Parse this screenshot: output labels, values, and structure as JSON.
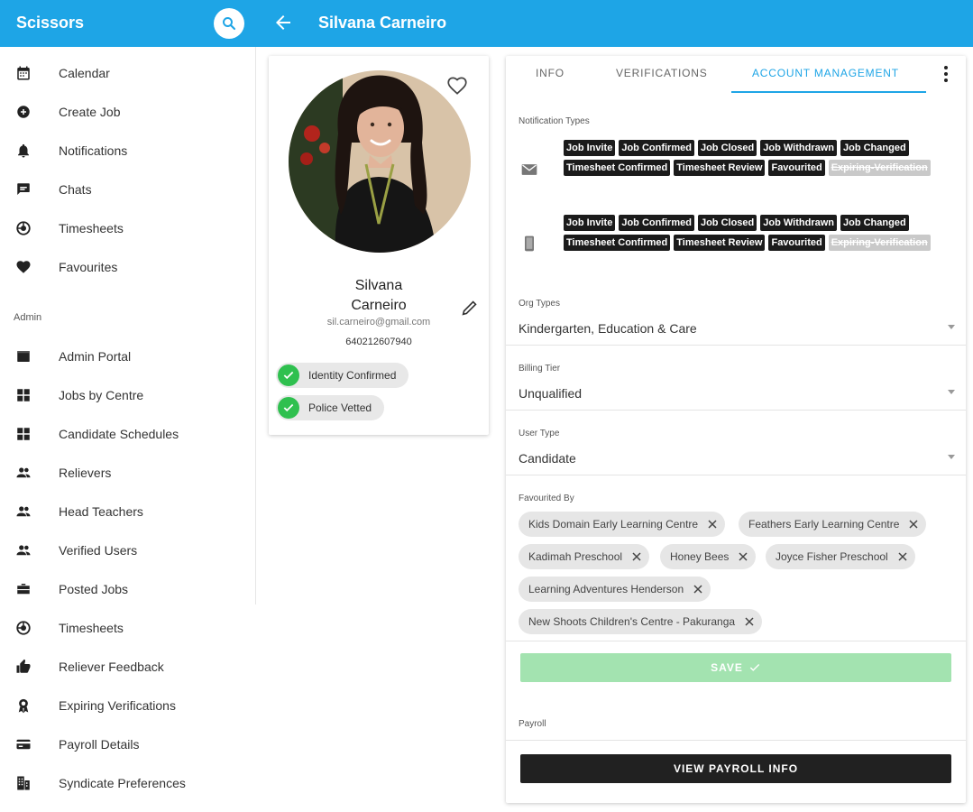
{
  "app": {
    "brand": "Scissors",
    "title": "Silvana Carneiro"
  },
  "sidebar": {
    "items": [
      {
        "label": "Calendar",
        "icon": "calendar-icon"
      },
      {
        "label": "Create Job",
        "icon": "add-circle-icon"
      },
      {
        "label": "Notifications",
        "icon": "bell-icon"
      },
      {
        "label": "Chats",
        "icon": "chat-icon"
      },
      {
        "label": "Timesheets",
        "icon": "timesheet-icon"
      },
      {
        "label": "Favourites",
        "icon": "heart-icon"
      }
    ],
    "admin_label": "Admin",
    "admin_items": [
      {
        "label": "Admin Portal",
        "icon": "portal-icon"
      },
      {
        "label": "Jobs by Centre",
        "icon": "grid-icon"
      },
      {
        "label": "Candidate Schedules",
        "icon": "grid-icon"
      },
      {
        "label": "Relievers",
        "icon": "people-icon"
      },
      {
        "label": "Head Teachers",
        "icon": "people-icon"
      },
      {
        "label": "Verified Users",
        "icon": "people-icon"
      },
      {
        "label": "Posted Jobs",
        "icon": "briefcase-icon"
      },
      {
        "label": "Timesheets",
        "icon": "timesheet-icon"
      },
      {
        "label": "Reliever Feedback",
        "icon": "thumbs-up-icon"
      },
      {
        "label": "Expiring Verifications",
        "icon": "award-icon"
      },
      {
        "label": "Payroll Details",
        "icon": "card-icon"
      },
      {
        "label": "Syndicate Preferences",
        "icon": "building-icon"
      }
    ]
  },
  "profile": {
    "first_name": "Silvana",
    "last_name": "Carneiro",
    "email": "sil.carneiro@gmail.com",
    "phone": "640212607940",
    "verifications": [
      "Identity Confirmed",
      "Police Vetted"
    ]
  },
  "tabs": [
    "INFO",
    "VERIFICATIONS",
    "ACCOUNT MANAGEMENT"
  ],
  "active_tab": "ACCOUNT MANAGEMENT",
  "notification_types": {
    "label": "Notification Types",
    "email": [
      "Job Invite",
      "Job Confirmed",
      "Job Closed",
      "Job Withdrawn",
      "Job Changed",
      "Timesheet Confirmed",
      "Timesheet Review",
      "Favourited"
    ],
    "email_disabled": [
      "Expiring-Verification"
    ],
    "mobile": [
      "Job Invite",
      "Job Confirmed",
      "Job Closed",
      "Job Withdrawn",
      "Job Changed",
      "Timesheet Confirmed",
      "Timesheet Review",
      "Favourited"
    ],
    "mobile_disabled": [
      "Expiring-Verification"
    ]
  },
  "org_types": {
    "label": "Org Types",
    "value": "Kindergarten, Education & Care"
  },
  "billing_tier": {
    "label": "Billing Tier",
    "value": "Unqualified"
  },
  "user_type": {
    "label": "User Type",
    "value": "Candidate"
  },
  "favourited_by": {
    "label": "Favourited By",
    "items": [
      "Kids Domain Early Learning Centre",
      "Feathers Early Learning Centre",
      "Kadimah Preschool",
      "Honey Bees",
      "Joyce Fisher Preschool",
      "Learning Adventures Henderson",
      "New Shoots Children's Centre - Pakuranga"
    ]
  },
  "save_label": "SAVE",
  "payroll": {
    "label": "Payroll",
    "button": "VIEW PAYROLL INFO"
  },
  "colors": {
    "primary": "#1ea5e6",
    "success": "#2fc04f",
    "save_disabled": "#a3e3b0",
    "dark": "#212121"
  }
}
